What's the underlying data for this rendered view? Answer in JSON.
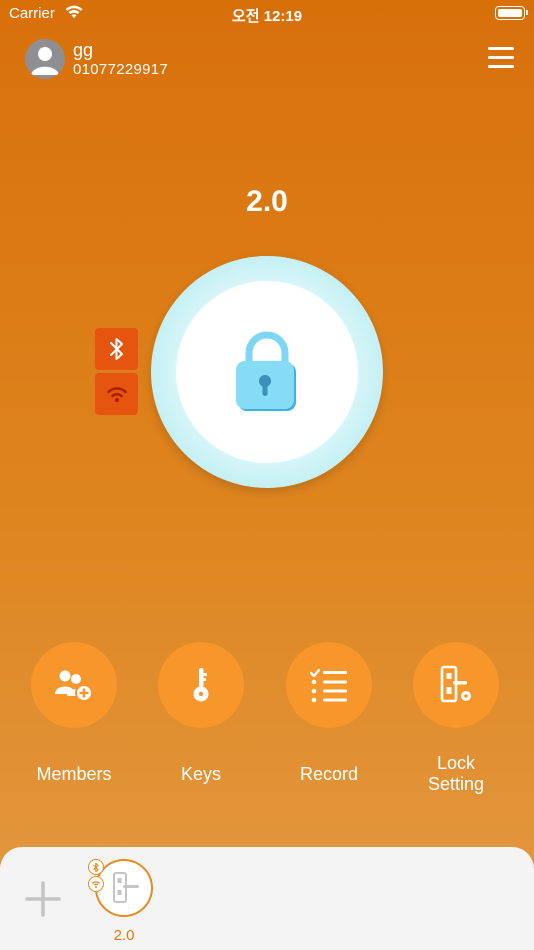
{
  "status_bar": {
    "carrier": "Carrier",
    "time": "오전 12:19"
  },
  "user": {
    "name": "gg",
    "phone": "01077229917"
  },
  "lock": {
    "name": "2.0",
    "state_icon": "unlocked-padlock-icon"
  },
  "connections": [
    {
      "icon": "bluetooth-icon"
    },
    {
      "icon": "wifi-icon"
    }
  ],
  "actions": [
    {
      "label": "Members",
      "icon": "add-member-icon"
    },
    {
      "label": "Keys",
      "icon": "key-icon"
    },
    {
      "label": "Record",
      "icon": "record-list-icon"
    },
    {
      "label": "Lock\nSetting",
      "icon": "lock-setting-icon"
    }
  ],
  "devices": [
    {
      "label": "2.0",
      "icon": "door-lock-icon"
    }
  ],
  "colors": {
    "accent": "#f7962a",
    "badge": "#e5550f",
    "ring": "#bfeef3",
    "padlock": "#7fd6f2"
  }
}
